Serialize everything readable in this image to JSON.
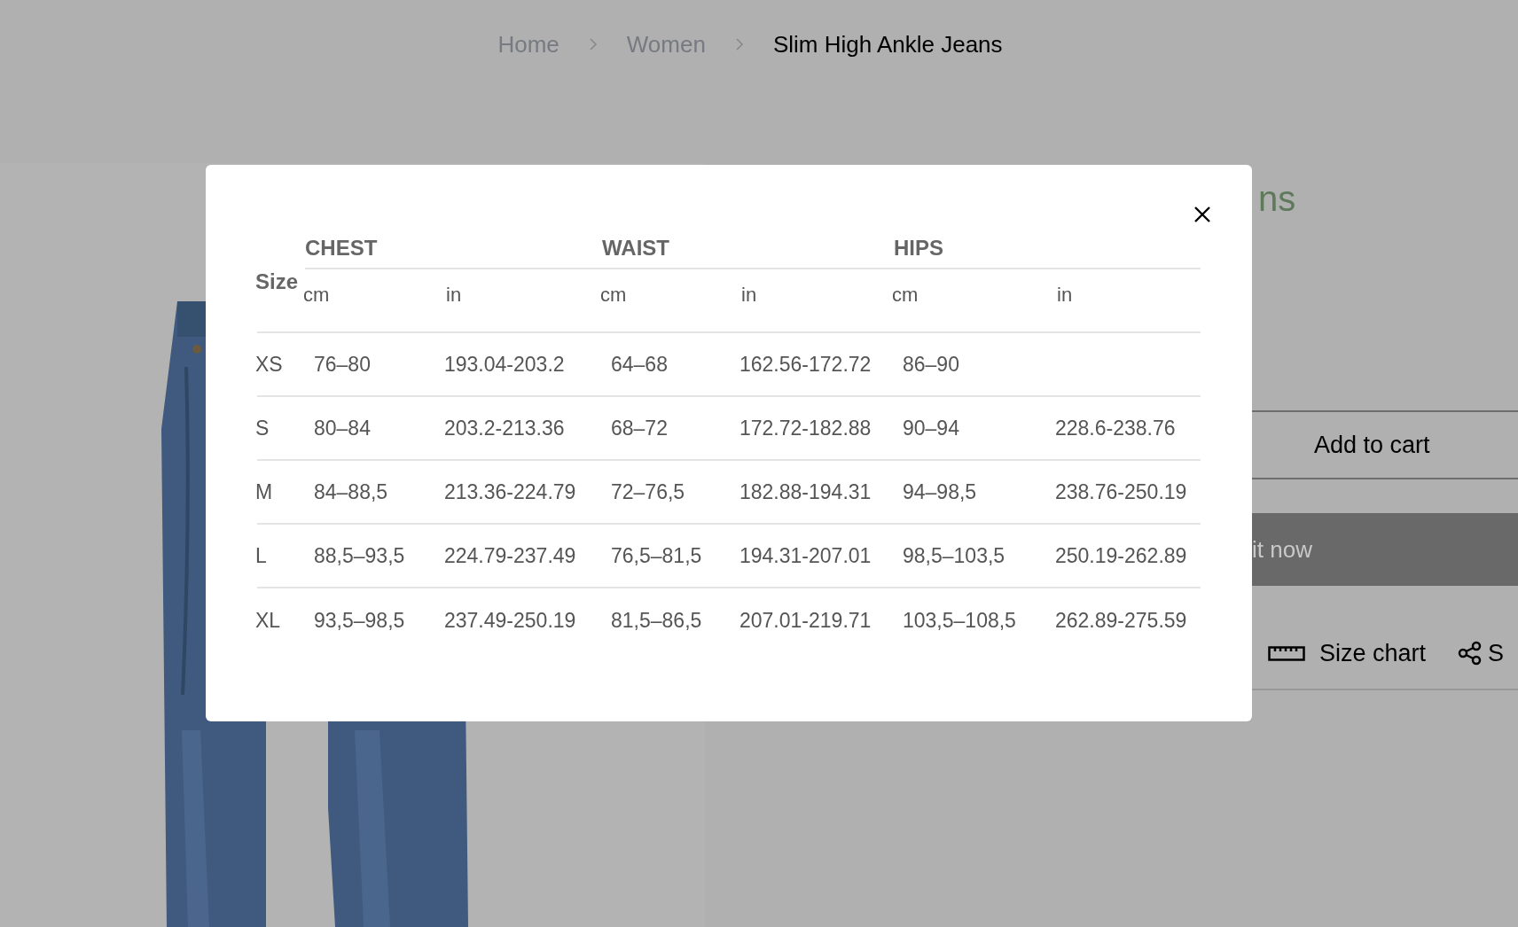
{
  "breadcrumb": [
    {
      "label": "Home",
      "current": false
    },
    {
      "label": "Women",
      "current": false
    },
    {
      "label": "Slim High Ankle Jeans",
      "current": true
    }
  ],
  "product": {
    "title_fragment": "ns",
    "add_to_cart": "Add to cart",
    "buy_now_fragment": "it now",
    "size_chart_link": "Size chart",
    "share_fragment": "S"
  },
  "size_chart_modal": {
    "size_header": "Size",
    "groups": [
      "CHEST",
      "WAIST",
      "HIPS"
    ],
    "units": [
      "cm",
      "in",
      "cm",
      "in",
      "cm",
      "in"
    ],
    "rows": [
      {
        "size": "XS",
        "values": [
          "76–80",
          "193.04-203.2",
          "64–68",
          "162.56-172.72",
          "86–90"
        ]
      },
      {
        "size": "S",
        "values": [
          "80–84",
          "203.2-213.36",
          "68–72",
          "172.72-182.88",
          "90–94",
          "228.6-238.76"
        ]
      },
      {
        "size": "M",
        "values": [
          "84–88,5",
          "213.36-224.79",
          "72–76,5",
          "182.88-194.31",
          "94–98,5",
          "238.76-250.19"
        ]
      },
      {
        "size": "L",
        "values": [
          "88,5–93,5",
          "224.79-237.49",
          "76,5–81,5",
          "194.31-207.01",
          "98,5–103,5",
          "250.19-262.89"
        ]
      },
      {
        "size": "XL",
        "values": [
          "93,5–98,5",
          "237.49-250.19",
          "81,5–86,5",
          "207.01-219.71",
          "103,5–108,5",
          "262.89-275.59"
        ]
      }
    ]
  }
}
